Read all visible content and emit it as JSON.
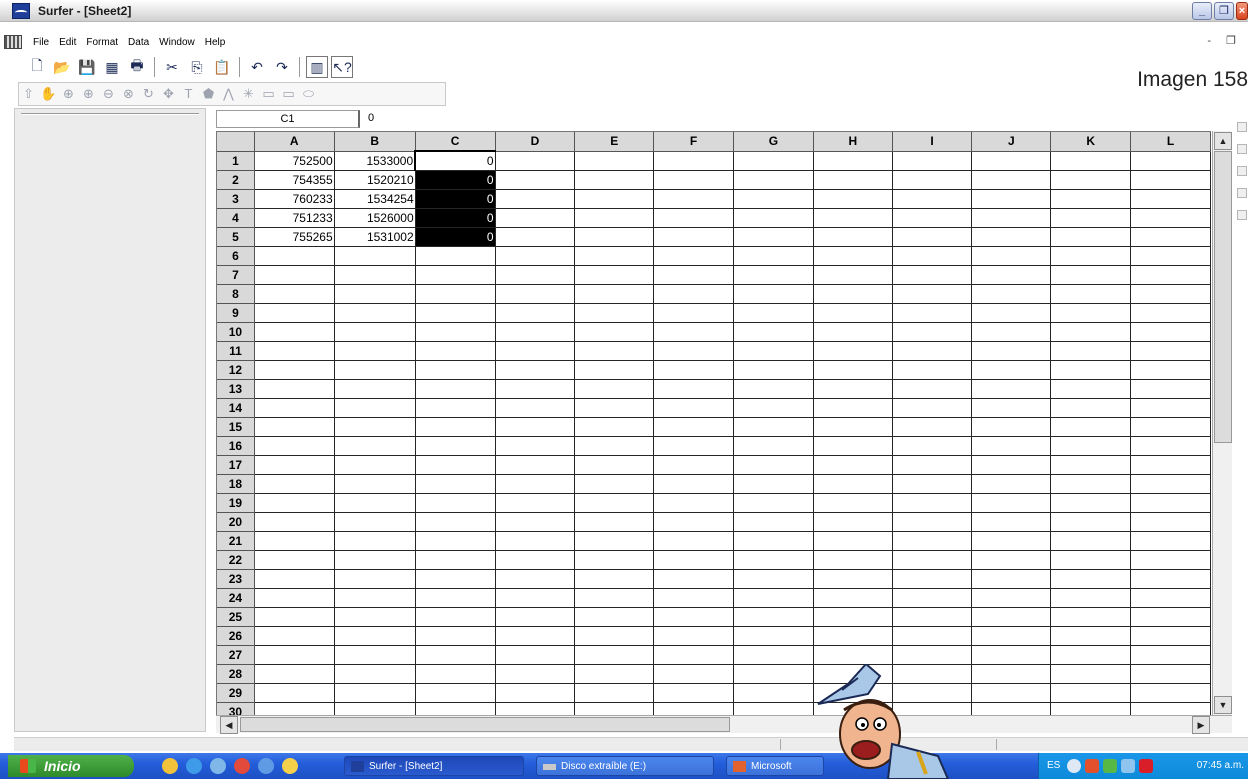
{
  "window": {
    "title": "Surfer - [Sheet2]",
    "controls": {
      "minimize": "_",
      "restore": "❐",
      "close": "×"
    }
  },
  "menu": {
    "items": [
      "File",
      "Edit",
      "Format",
      "Data",
      "Window",
      "Help"
    ],
    "mdi_controls": "- ❐"
  },
  "toolbar1": {
    "icons": [
      "new-icon",
      "open-icon",
      "save-icon",
      "worksheet-icon",
      "print-icon",
      "cut-icon",
      "copy-icon",
      "paste-icon",
      "undo-icon",
      "redo-icon",
      "toolbar-icon",
      "help-pointer-icon"
    ]
  },
  "toolbar2": {
    "icons": [
      "select-icon",
      "pan-icon",
      "zoom-in-icon",
      "zoom-rect-icon",
      "zoom-out-icon",
      "zoom-selection-icon",
      "rotate-icon",
      "move-icon",
      "text-icon",
      "polygon-icon",
      "polyline-icon",
      "symbol-icon",
      "rectangle-icon",
      "rounded-rect-icon",
      "ellipse-icon"
    ]
  },
  "overlay_label": "Imagen 158",
  "formula_bar": {
    "cell_ref": "C1",
    "value": "0"
  },
  "sheet": {
    "columns": [
      "A",
      "B",
      "C",
      "D",
      "E",
      "F",
      "G",
      "H",
      "I",
      "J",
      "K",
      "L"
    ],
    "row_count": 30,
    "rows": [
      {
        "A": "752500",
        "B": "1533000",
        "C": "0"
      },
      {
        "A": "754355",
        "B": "1520210",
        "C": "0"
      },
      {
        "A": "760233",
        "B": "1534254",
        "C": "0"
      },
      {
        "A": "751233",
        "B": "1526000",
        "C": "0"
      },
      {
        "A": "755265",
        "B": "1531002",
        "C": "0"
      }
    ],
    "active_cell": "C1",
    "selected_range": "C2:C5"
  },
  "taskbar": {
    "start_label": "Inicio",
    "tasks": [
      "Surfer - [Sheet2]",
      "Disco extraíble (E:)",
      "Microsoft"
    ],
    "tray_lang": "ES",
    "clock": "07:45 a.m."
  }
}
